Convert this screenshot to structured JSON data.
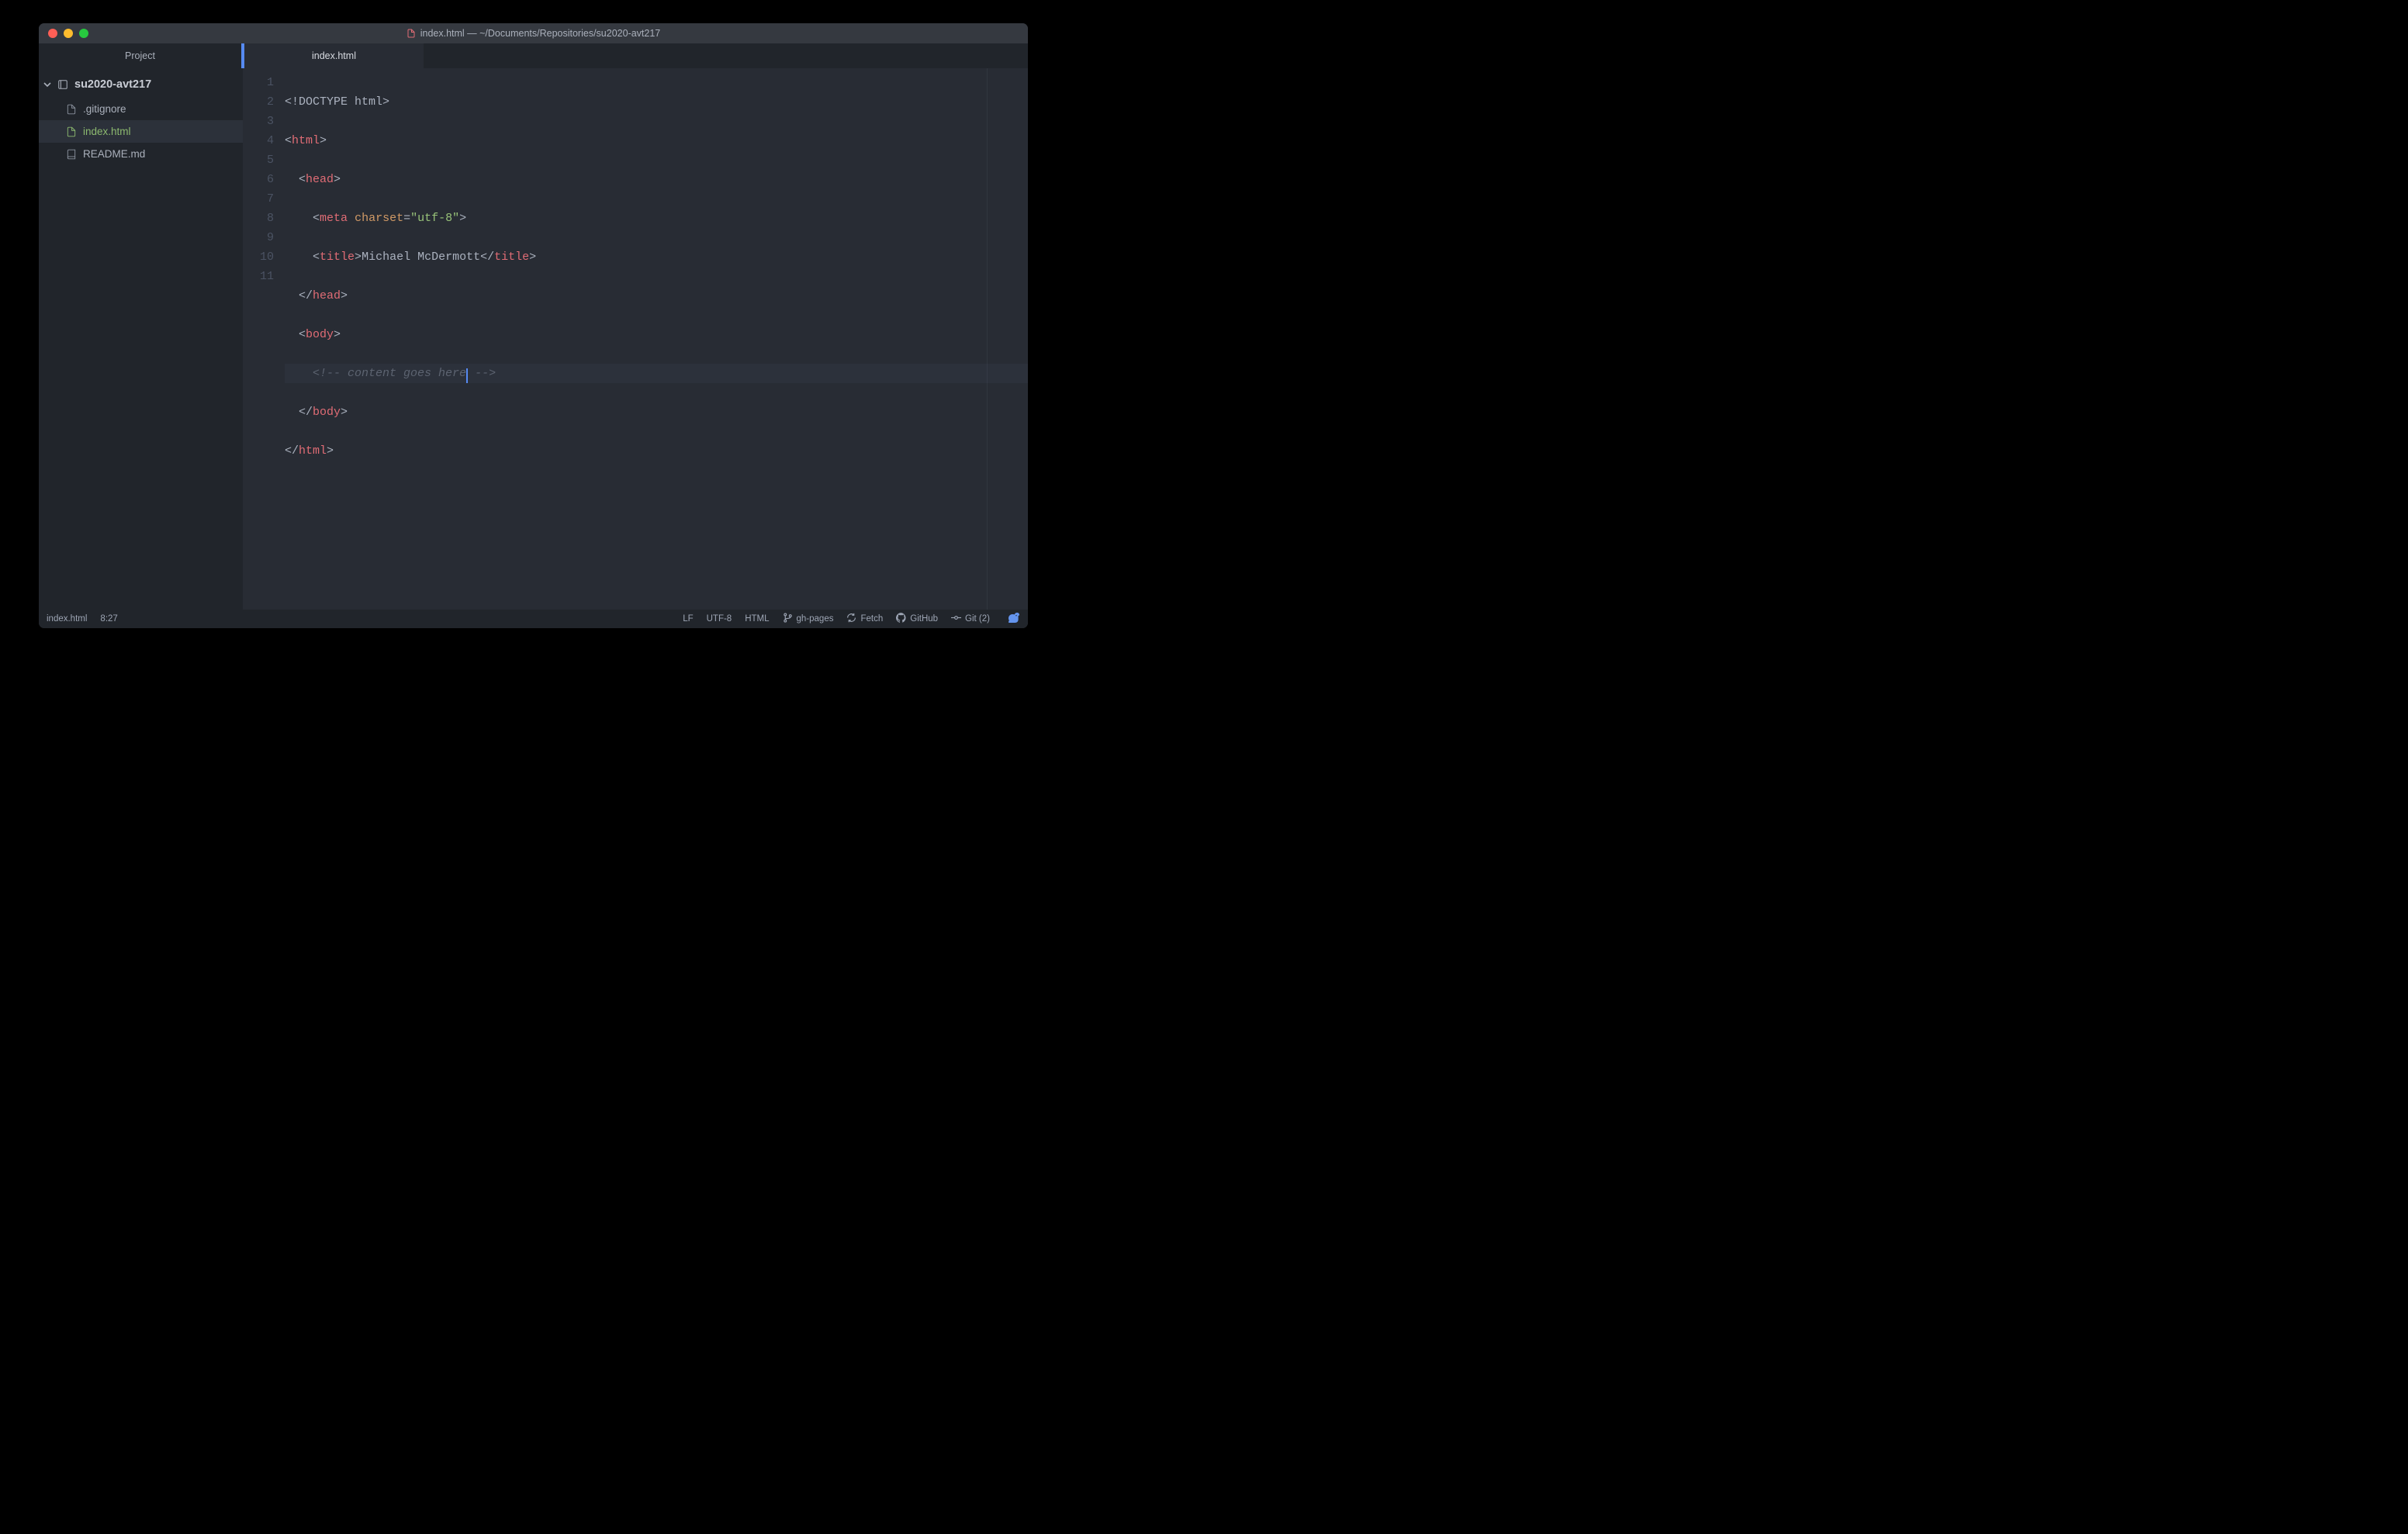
{
  "window": {
    "title": "index.html — ~/Documents/Repositories/su2020-avt217"
  },
  "sidebar": {
    "tab_label": "Project",
    "root": "su2020-avt217",
    "items": [
      {
        "name": ".gitignore",
        "icon": "file"
      },
      {
        "name": "index.html",
        "icon": "file",
        "selected": true
      },
      {
        "name": "README.md",
        "icon": "book"
      }
    ]
  },
  "editor": {
    "tab": "index.html",
    "line_numbers": [
      "1",
      "2",
      "3",
      "4",
      "5",
      "6",
      "7",
      "8",
      "9",
      "10",
      "11"
    ],
    "cursor_line": 8,
    "content": {
      "doctype": "<!DOCTYPE html>",
      "tags": {
        "html": "html",
        "head": "head",
        "meta": "meta",
        "title": "title",
        "body": "body"
      },
      "attrs": {
        "charset": "charset"
      },
      "values": {
        "utf8": "\"utf-8\""
      },
      "title_text": "Michael McDermott",
      "comment": " content goes here"
    }
  },
  "statusbar": {
    "file": "index.html",
    "cursor": "8:27",
    "line_ending": "LF",
    "encoding": "UTF-8",
    "grammar": "HTML",
    "branch": "gh-pages",
    "fetch": "Fetch",
    "github": "GitHub",
    "git": "Git (2)"
  }
}
